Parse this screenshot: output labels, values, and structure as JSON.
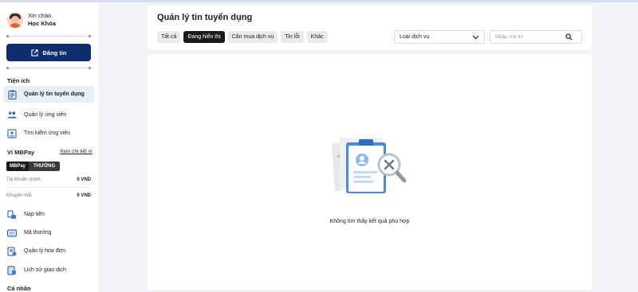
{
  "sidebar": {
    "greeting": "Xin chào,",
    "user_name": "Học Khóa",
    "post_button": "Đăng tin",
    "utilities_title": "Tiện ích",
    "utilities": [
      {
        "label": "Quản lý tin tuyển dụng",
        "icon": "clipboard-icon",
        "active": true
      },
      {
        "label": "Quản lý ứng viên",
        "icon": "users-icon",
        "active": false
      },
      {
        "label": "Tìm kiếm ứng viên",
        "icon": "search-user-icon",
        "active": false
      }
    ],
    "wallet_title": "Ví MBPay",
    "wallet_link": "Xem chi tiết ví",
    "wallet_brand": "MBPay",
    "wallet_tier": "THƯỜNG",
    "balances": [
      {
        "label": "Tài khoản chính",
        "value": "0 VND"
      },
      {
        "label": "Khuyến mãi",
        "value": "0 VND"
      }
    ],
    "wallet_items": [
      {
        "label": "Nạp tiền",
        "icon": "top-up-icon"
      },
      {
        "label": "Mã thưởng",
        "icon": "voucher-icon"
      },
      {
        "label": "Quản lý hóa đơn",
        "icon": "invoice-icon"
      },
      {
        "label": "Lịch sử giao dịch",
        "icon": "history-icon"
      }
    ],
    "personal_title": "Cá nhân"
  },
  "main": {
    "title": "Quản lý tin tuyển dụng",
    "tabs": [
      {
        "label": "Tất cả",
        "active": false
      },
      {
        "label": "Đang hiển thị",
        "active": true
      },
      {
        "label": "Cần mua dịch vụ",
        "active": false
      },
      {
        "label": "Tin lỗi",
        "active": false
      },
      {
        "label": "Khác",
        "active": false
      }
    ],
    "service_select": "Loại dịch vụ",
    "search_placeholder": "Nhập mã tin",
    "empty_message": "Không tìm thấy kết quả phù hợp"
  },
  "colors": {
    "primary": "#0d2e6e",
    "active_nav_bg": "#e7effb",
    "illustration_blue": "#5a9be8"
  }
}
